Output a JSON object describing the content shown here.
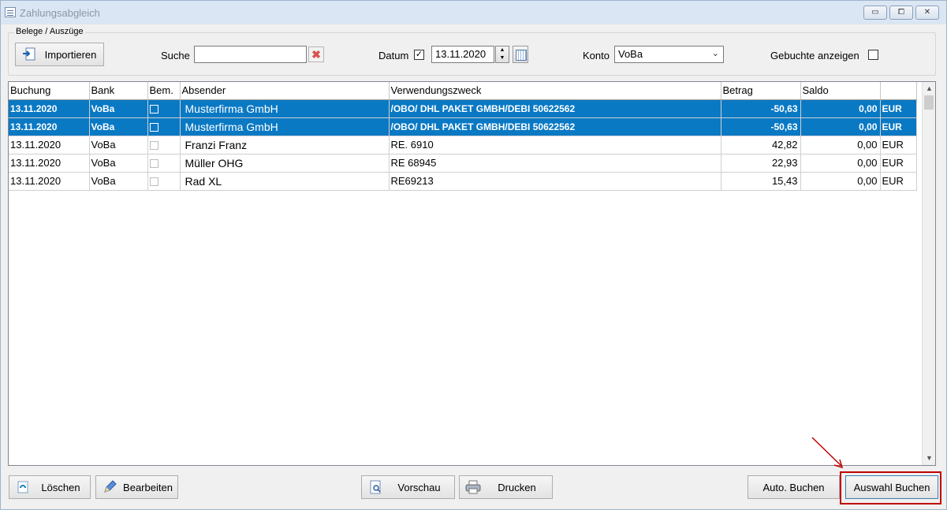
{
  "window": {
    "title": "Zahlungsabgleich"
  },
  "toolbar": {
    "group_label": "Belege / Auszüge",
    "import_label": "Importieren",
    "search_label": "Suche",
    "search_value": "",
    "date_label": "Datum",
    "date_checked": true,
    "date_value": "13.11.2020",
    "account_label": "Konto",
    "account_value": "VoBa",
    "show_booked_label": "Gebuchte anzeigen",
    "show_booked_checked": false
  },
  "table": {
    "columns": [
      "Buchung",
      "Bank",
      "Bem.",
      "Absender",
      "Verwendungszweck",
      "Betrag",
      "Saldo",
      ""
    ],
    "rows": [
      {
        "buchung": "13.11.2020",
        "bank": "VoBa",
        "absender": "Musterfirma GmbH",
        "zweck": "/OBO/ DHL PAKET GMBH/DEBI 50622562",
        "betrag": "-50,63",
        "saldo": "0,00",
        "waehrung": "EUR",
        "selected": true
      },
      {
        "buchung": "13.11.2020",
        "bank": "VoBa",
        "absender": "Musterfirma GmbH",
        "zweck": "/OBO/ DHL PAKET GMBH/DEBI 50622562",
        "betrag": "-50,63",
        "saldo": "0,00",
        "waehrung": "EUR",
        "selected": true
      },
      {
        "buchung": "13.11.2020",
        "bank": "VoBa",
        "absender": "Franzi Franz",
        "zweck": "RE. 6910",
        "betrag": "42,82",
        "saldo": "0,00",
        "waehrung": "EUR",
        "selected": false
      },
      {
        "buchung": "13.11.2020",
        "bank": "VoBa",
        "absender": "Müller OHG",
        "zweck": "RE 68945",
        "betrag": "22,93",
        "saldo": "0,00",
        "waehrung": "EUR",
        "selected": false
      },
      {
        "buchung": "13.11.2020",
        "bank": "VoBa",
        "absender": "Rad XL",
        "zweck": "RE69213",
        "betrag": "15,43",
        "saldo": "0,00",
        "waehrung": "EUR",
        "selected": false
      }
    ]
  },
  "footer": {
    "delete_label": "Löschen",
    "edit_label": "Bearbeiten",
    "preview_label": "Vorschau",
    "print_label": "Drucken",
    "auto_book_label": "Auto. Buchen",
    "book_selection_label": "Auswahl Buchen"
  },
  "colors": {
    "selection": "#0a79c4",
    "highlight": "#c00000"
  }
}
